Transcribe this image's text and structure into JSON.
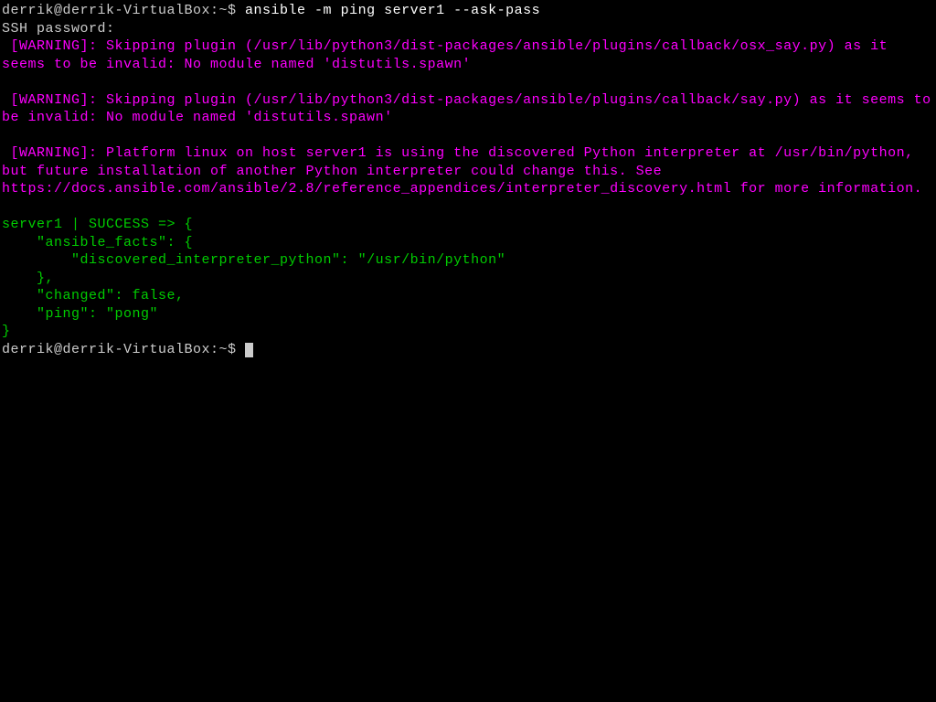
{
  "line1_prompt": "derrik@derrik-VirtualBox:~$ ",
  "line1_command": "ansible -m ping server1 --ask-pass",
  "line2": "SSH password:",
  "warning1": " [WARNING]: Skipping plugin (/usr/lib/python3/dist-packages/ansible/plugins/callback/osx_say.py) as it seems to be invalid: No module named 'distutils.spawn'",
  "warning2": " [WARNING]: Skipping plugin (/usr/lib/python3/dist-packages/ansible/plugins/callback/say.py) as it seems to be invalid: No module named 'distutils.spawn'",
  "warning3": " [WARNING]: Platform linux on host server1 is using the discovered Python interpreter at /usr/bin/python, but future installation of another Python interpreter could change this. See https://docs.ansible.com/ansible/2.8/reference_appendices/interpreter_discovery.html for more information.",
  "success_l1": "server1 | SUCCESS => {",
  "success_l2": "    \"ansible_facts\": {",
  "success_l3": "        \"discovered_interpreter_python\": \"/usr/bin/python\"",
  "success_l4": "    },",
  "success_l5": "    \"changed\": false,",
  "success_l6": "    \"ping\": \"pong\"",
  "success_l7": "}",
  "line_end_prompt": "derrik@derrik-VirtualBox:~$ "
}
